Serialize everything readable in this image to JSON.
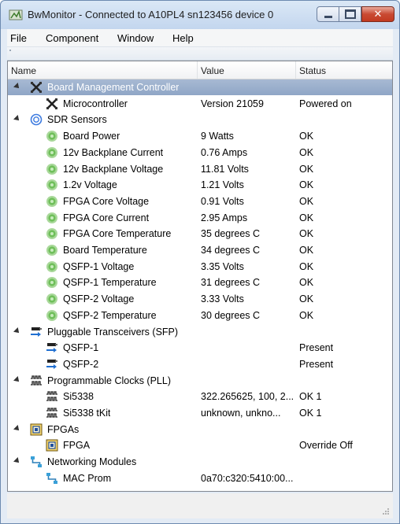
{
  "window": {
    "title": "BwMonitor - Connected to A10PL4 sn123456 device 0",
    "close_glyph": "✕"
  },
  "menu": [
    "File",
    "Component",
    "Window",
    "Help"
  ],
  "columns": {
    "name": "Name",
    "value": "Value",
    "status": "Status"
  },
  "rows": [
    {
      "level": 0,
      "icon": "chip-x-icon",
      "name": "Board Management Controller",
      "value": "",
      "status": "",
      "selected": true
    },
    {
      "level": 1,
      "icon": "chip-x-icon",
      "name": "Microcontroller",
      "value": "Version 21059",
      "status": "Powered on"
    },
    {
      "level": 0,
      "icon": "sensor-ring-icon",
      "name": "SDR Sensors",
      "value": "",
      "status": ""
    },
    {
      "level": 1,
      "icon": "sensor-ok-icon",
      "name": "Board Power",
      "value": "9 Watts",
      "status": "OK"
    },
    {
      "level": 1,
      "icon": "sensor-ok-icon",
      "name": "12v Backplane Current",
      "value": "0.76 Amps",
      "status": "OK"
    },
    {
      "level": 1,
      "icon": "sensor-ok-icon",
      "name": "12v Backplane Voltage",
      "value": "11.81 Volts",
      "status": "OK"
    },
    {
      "level": 1,
      "icon": "sensor-ok-icon",
      "name": "1.2v Voltage",
      "value": "1.21 Volts",
      "status": "OK"
    },
    {
      "level": 1,
      "icon": "sensor-ok-icon",
      "name": "FPGA Core Voltage",
      "value": "0.91 Volts",
      "status": "OK"
    },
    {
      "level": 1,
      "icon": "sensor-ok-icon",
      "name": "FPGA Core Current",
      "value": "2.95 Amps",
      "status": "OK"
    },
    {
      "level": 1,
      "icon": "sensor-ok-icon",
      "name": "FPGA Core Temperature",
      "value": "35 degrees C",
      "status": "OK"
    },
    {
      "level": 1,
      "icon": "sensor-ok-icon",
      "name": "Board Temperature",
      "value": "34 degrees C",
      "status": "OK"
    },
    {
      "level": 1,
      "icon": "sensor-ok-icon",
      "name": "QSFP-1 Voltage",
      "value": "3.35 Volts",
      "status": "OK"
    },
    {
      "level": 1,
      "icon": "sensor-ok-icon",
      "name": "QSFP-1 Temperature",
      "value": "31 degrees C",
      "status": "OK"
    },
    {
      "level": 1,
      "icon": "sensor-ok-icon",
      "name": "QSFP-2 Voltage",
      "value": "3.33 Volts",
      "status": "OK"
    },
    {
      "level": 1,
      "icon": "sensor-ok-icon",
      "name": "QSFP-2 Temperature",
      "value": "30 degrees C",
      "status": "OK"
    },
    {
      "level": 0,
      "icon": "transceiver-icon",
      "name": "Pluggable Transceivers (SFP)",
      "value": "",
      "status": ""
    },
    {
      "level": 1,
      "icon": "transceiver-icon",
      "name": "QSFP-1",
      "value": "",
      "status": "Present"
    },
    {
      "level": 1,
      "icon": "transceiver-icon",
      "name": "QSFP-2",
      "value": "",
      "status": "Present"
    },
    {
      "level": 0,
      "icon": "clock-wave-icon",
      "name": "Programmable Clocks (PLL)",
      "value": "",
      "status": ""
    },
    {
      "level": 1,
      "icon": "clock-wave-icon",
      "name": "Si5338",
      "value": "322.265625, 100, 2...",
      "status": "OK 1"
    },
    {
      "level": 1,
      "icon": "clock-wave-icon",
      "name": "Si5338 tKit",
      "value": "unknown, unkno...",
      "status": "OK 1"
    },
    {
      "level": 0,
      "icon": "fpga-chip-icon",
      "name": "FPGAs",
      "value": "",
      "status": ""
    },
    {
      "level": 1,
      "icon": "fpga-chip-icon",
      "name": "FPGA",
      "value": "",
      "status": "Override Off"
    },
    {
      "level": 0,
      "icon": "network-module-icon",
      "name": "Networking Modules",
      "value": "",
      "status": ""
    },
    {
      "level": 1,
      "icon": "network-module-icon",
      "name": "MAC Prom",
      "value": "0a70:c320:5410:00...",
      "status": ""
    }
  ],
  "colors": {
    "selection": "#8fa6c6",
    "sensor_green": "#6fbf5a",
    "arrow_blue": "#1f6fd1"
  }
}
